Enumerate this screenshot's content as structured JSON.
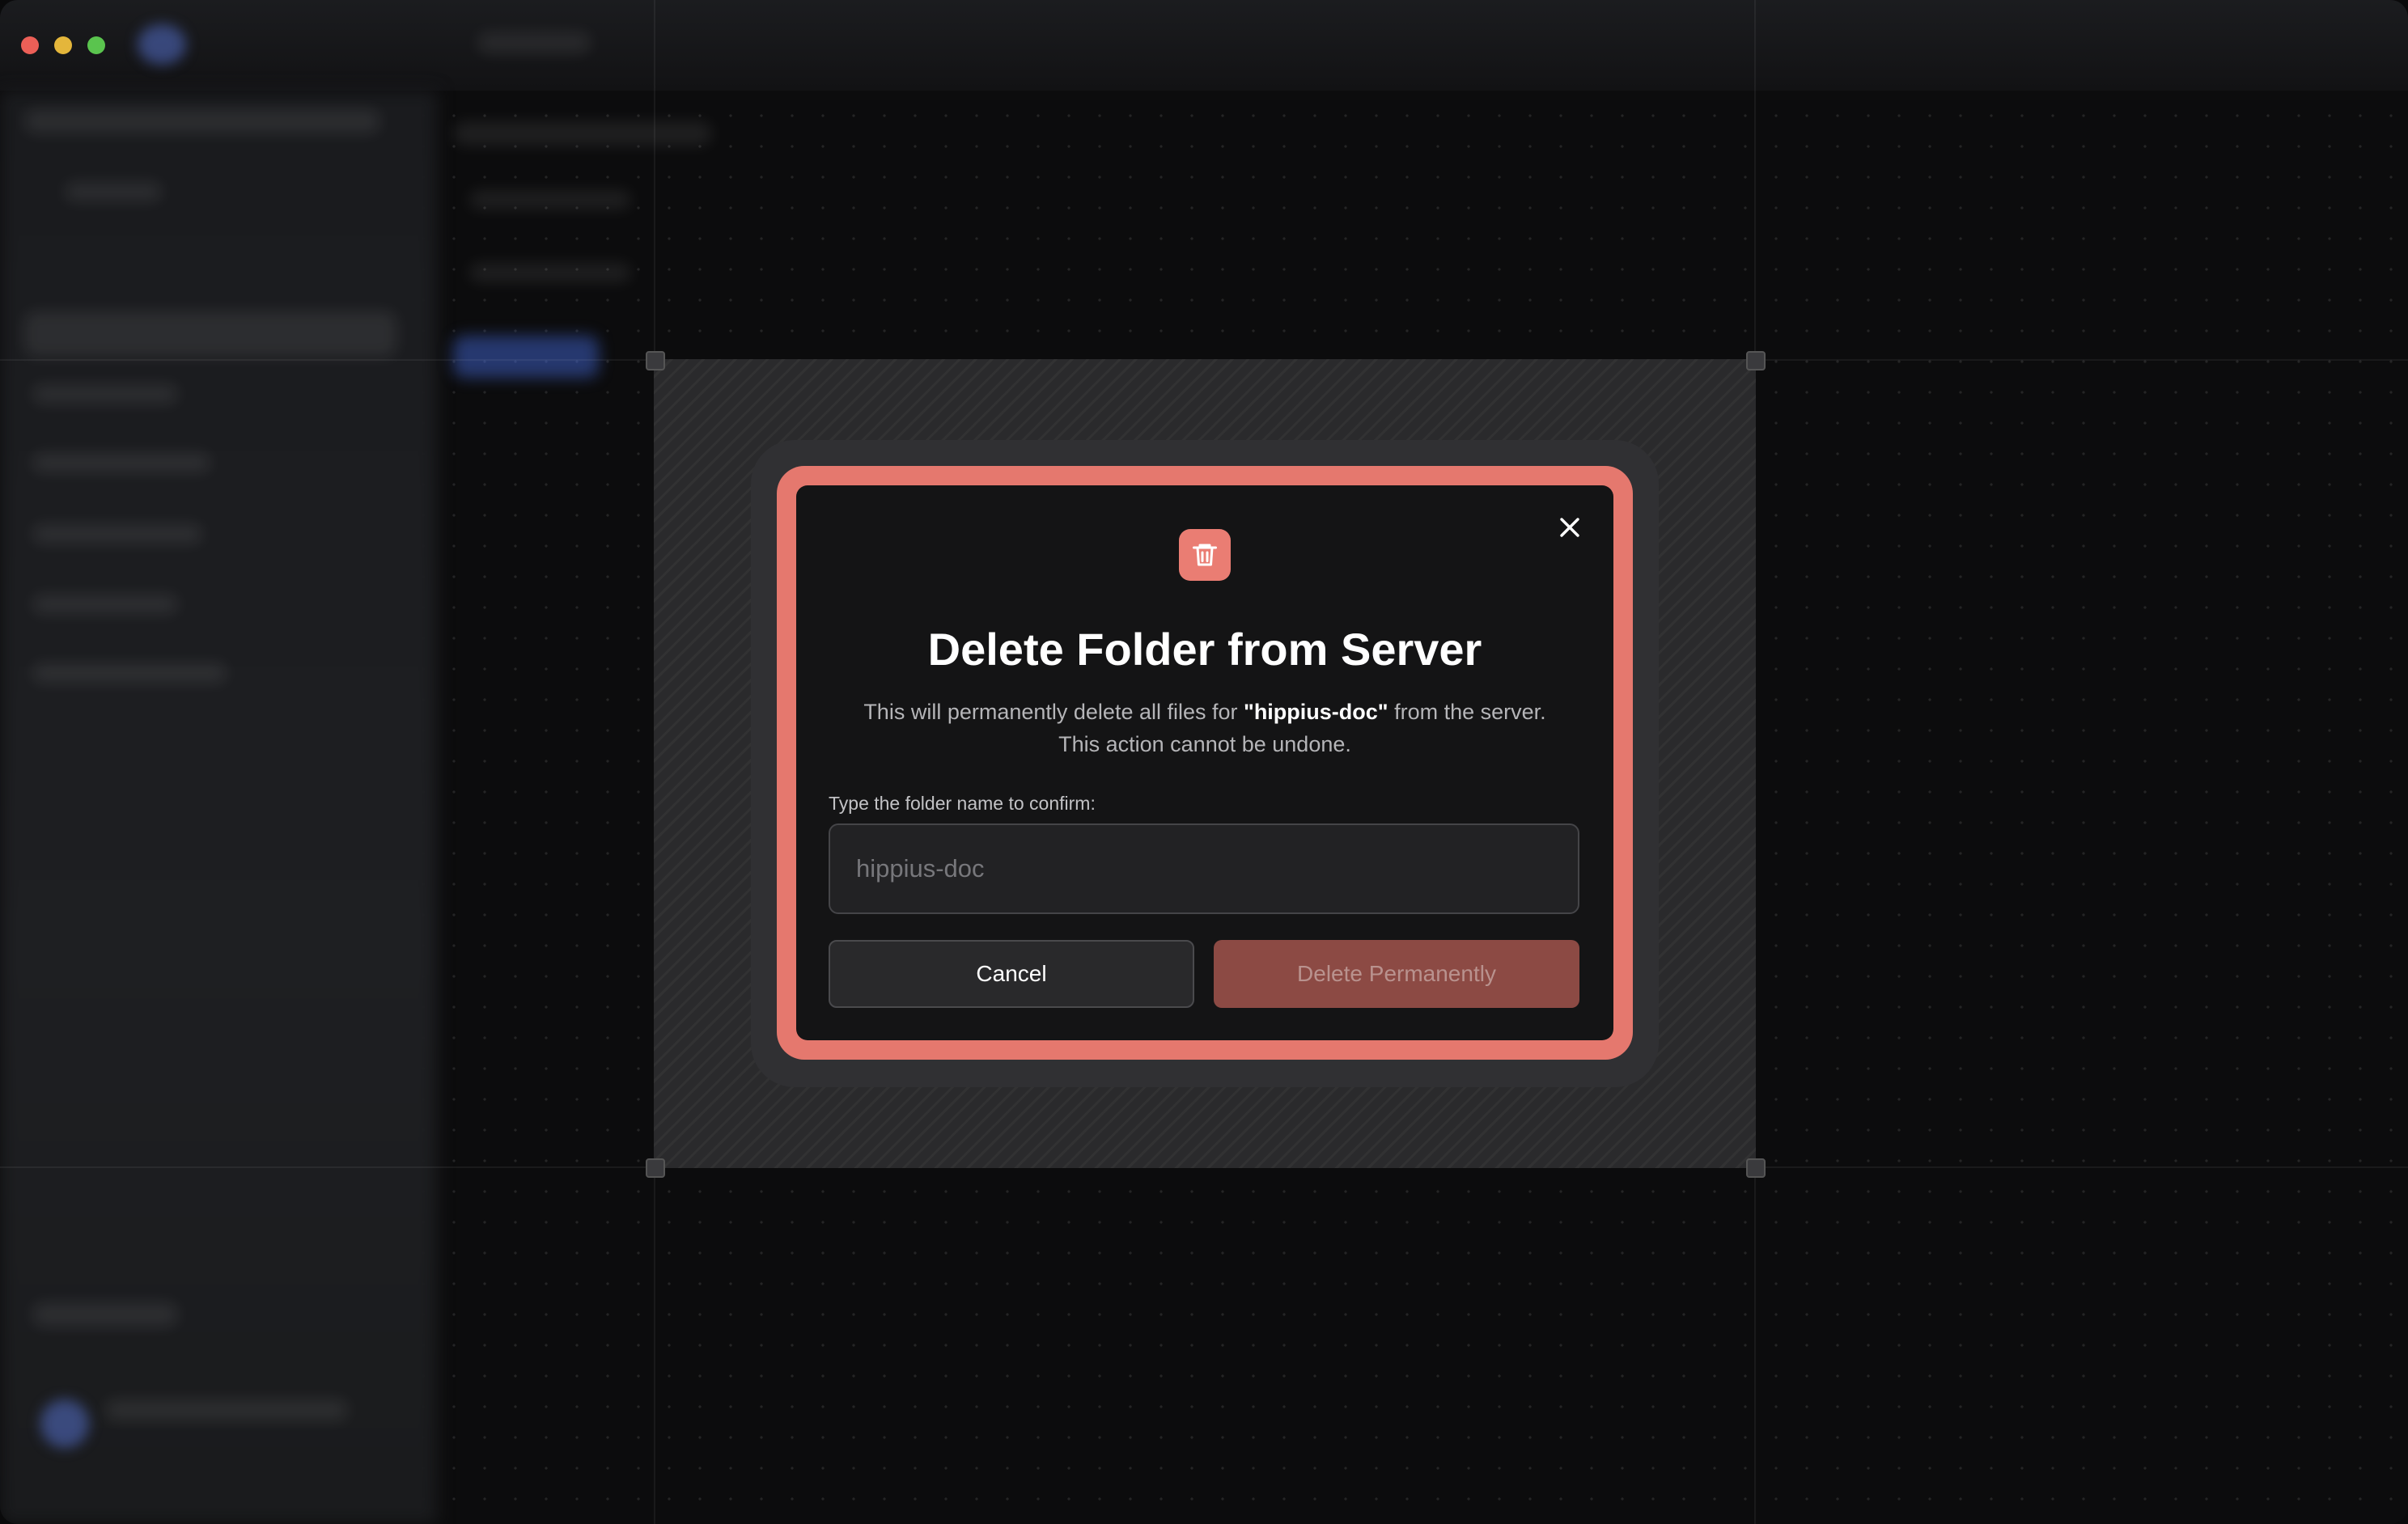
{
  "window": {
    "traffic_lights": {
      "close_color": "#ec5f57",
      "minimize_color": "#e4b63b",
      "maximize_color": "#5ac44e"
    }
  },
  "dialog": {
    "icon": "trash-icon",
    "title": "Delete Folder from Server",
    "description_prefix": "This will permanently delete all files for ",
    "folder_name_quoted": "\"hippius-doc\"",
    "description_suffix": " from the server.",
    "description_line2": "This action cannot be undone.",
    "confirm_label": "Type the folder name to confirm:",
    "confirm_input": {
      "value": "",
      "placeholder": "hippius-doc"
    },
    "cancel_label": "Cancel",
    "delete_label": "Delete Permanently",
    "close_icon": "close-icon",
    "colors": {
      "accent": "#e5786e",
      "delete_button_disabled": "#8c4a44"
    }
  }
}
